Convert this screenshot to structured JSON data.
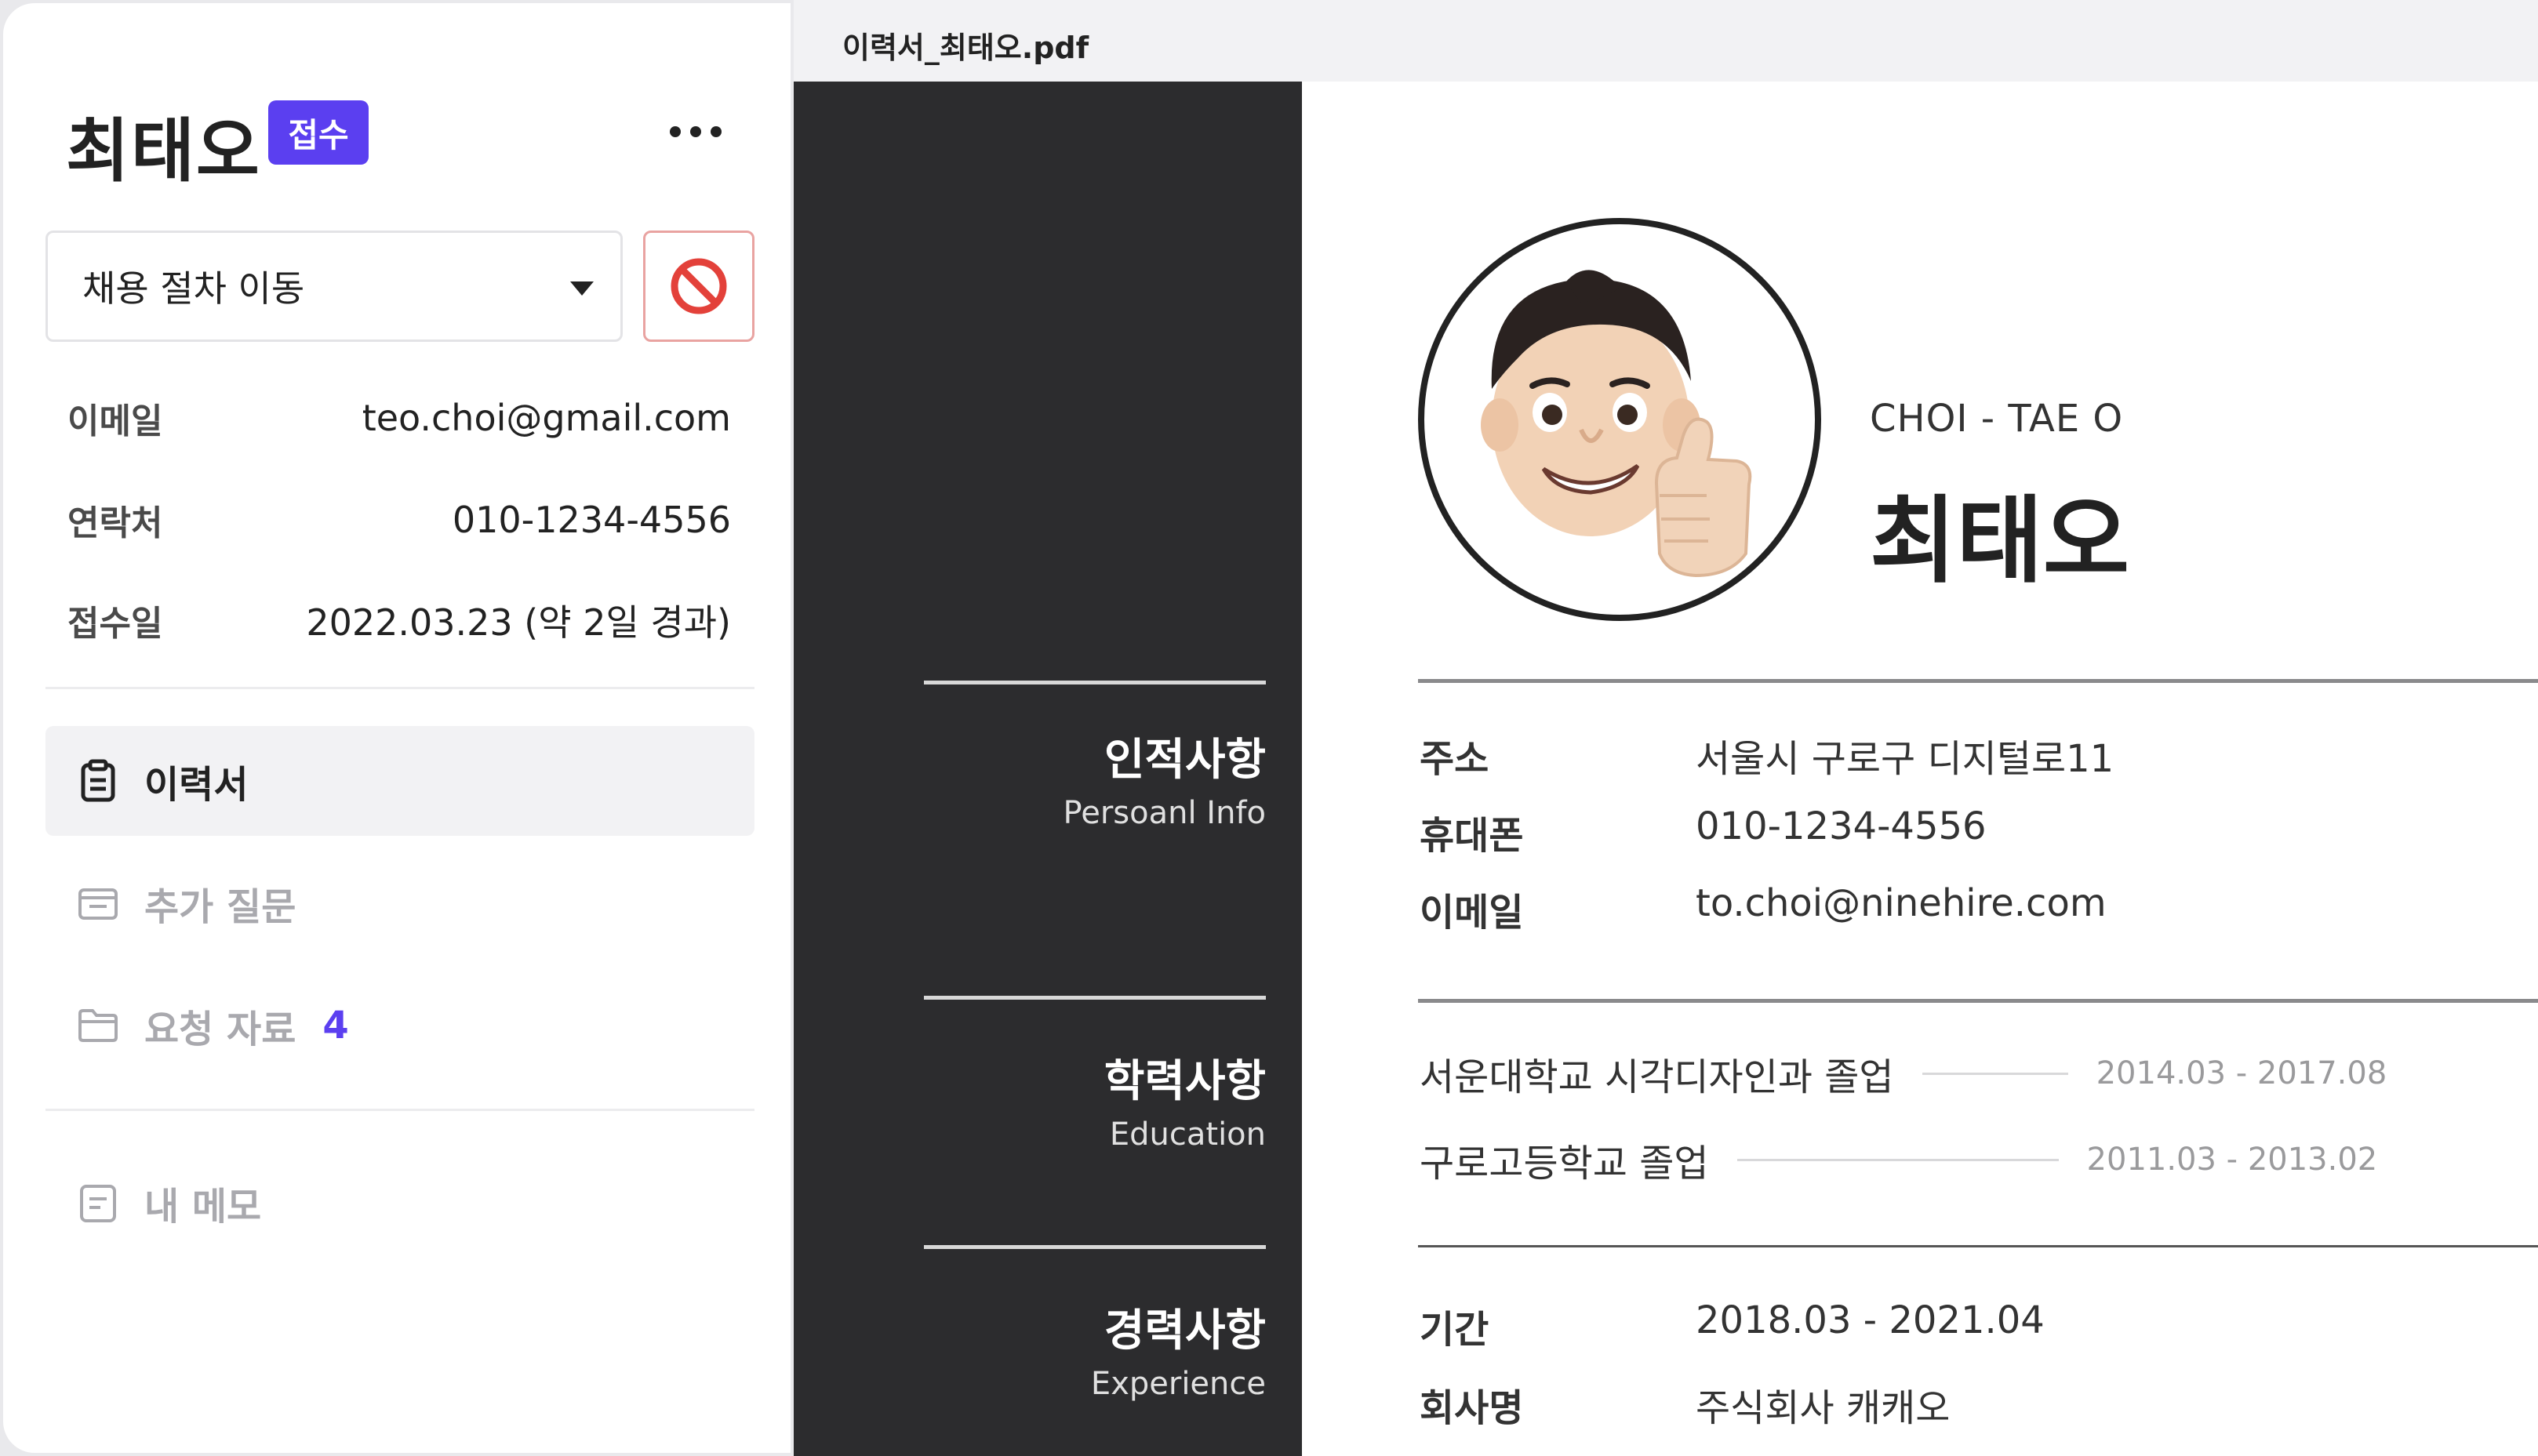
{
  "applicant": {
    "name": "최태오",
    "status_badge": "접수"
  },
  "actions": {
    "stage_dropdown": "채용 절차 이동"
  },
  "info": [
    {
      "label": "이메일",
      "value": "teo.choi@gmail.com"
    },
    {
      "label": "연락처",
      "value": "010-1234-4556"
    },
    {
      "label": "접수일",
      "value": "2022.03.23 (약 2일 경과)"
    }
  ],
  "nav": {
    "resume": "이력서",
    "extra_questions": "추가 질문",
    "requested_docs": "요청 자료",
    "requested_docs_count": "4",
    "memo": "내 메모"
  },
  "viewer": {
    "filename": "이력서_최태오.pdf"
  },
  "resume": {
    "name_en": "CHOI - TAE O",
    "name_ko": "최태오",
    "sections": {
      "personal": {
        "title": "인적사항",
        "subtitle": "Persoanl Info"
      },
      "education": {
        "title": "학력사항",
        "subtitle": "Education"
      },
      "experience": {
        "title": "경력사항",
        "subtitle": "Experience"
      }
    },
    "personal": [
      {
        "label": "주소",
        "value": "서울시 구로구 디지털로11"
      },
      {
        "label": "휴대폰",
        "value": "010-1234-4556"
      },
      {
        "label": "이메일",
        "value": "to.choi@ninehire.com"
      }
    ],
    "education": [
      {
        "school": "서운대학교 시각디자인과 졸업",
        "period": "2014.03 - 2017.08"
      },
      {
        "school": "구로고등학교 졸업",
        "period": "2011.03 - 2013.02"
      }
    ],
    "experience": [
      {
        "label": "기간",
        "value": "2018.03 - 2021.04"
      },
      {
        "label": "회사명",
        "value": "주식회사 캐캐오"
      }
    ]
  },
  "colors": {
    "accent": "#5b3ff0",
    "danger": "#e3413a",
    "dark_column": "#2c2c2e"
  },
  "icons": [
    "more-icon",
    "chevron-down-icon",
    "block-icon",
    "clipboard-icon",
    "inbox-icon",
    "folder-icon",
    "memo-icon"
  ]
}
